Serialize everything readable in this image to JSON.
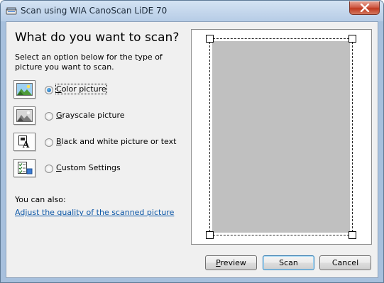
{
  "window": {
    "title": "Scan using WIA CanoScan LiDE 70"
  },
  "main": {
    "heading": "What do you want to scan?",
    "instructions": "Select an option below for the type of picture you want to scan.",
    "options": [
      {
        "label_accel": "C",
        "label_rest": "olor picture",
        "selected": true,
        "icon": "color-photo-icon"
      },
      {
        "label_accel": "G",
        "label_rest": "rayscale picture",
        "selected": false,
        "icon": "grayscale-photo-icon"
      },
      {
        "label_accel": "B",
        "label_rest": "lack and white picture or text",
        "selected": false,
        "icon": "black-white-text-icon"
      },
      {
        "label_accel": "C",
        "label_rest": "ustom Settings",
        "selected": false,
        "icon": "custom-settings-icon"
      }
    ],
    "also_label": "You can also:",
    "adjust_link": "Adjust the quality of the scanned picture"
  },
  "buttons": {
    "preview_accel": "P",
    "preview_rest": "review",
    "scan_label": "Scan",
    "cancel_label": "Cancel"
  },
  "colors": {
    "link": "#0c57a7",
    "scan_area": "#c0c0c0",
    "close_button": "#c0391f"
  }
}
